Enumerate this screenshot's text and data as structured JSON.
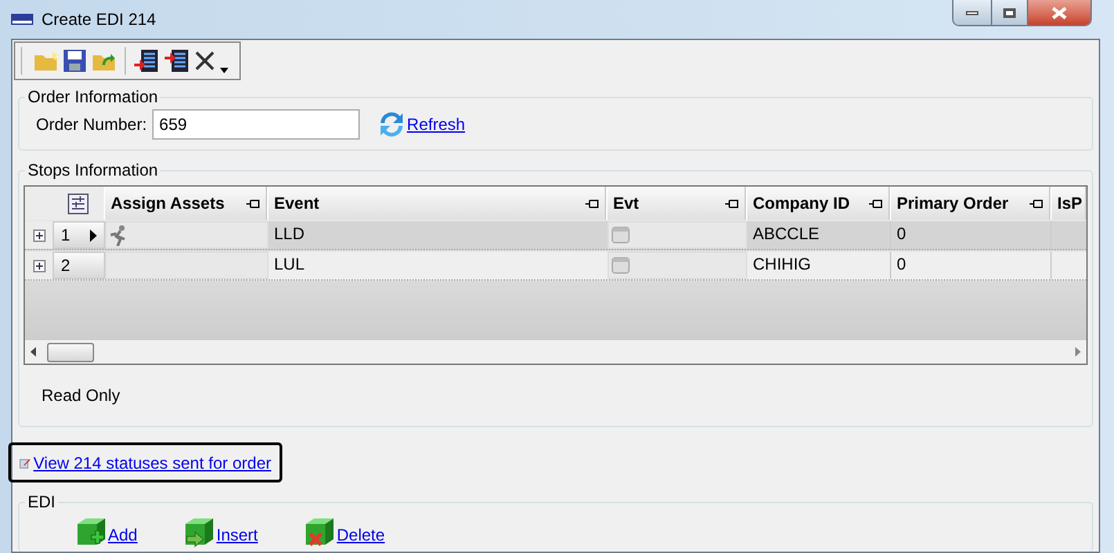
{
  "window": {
    "title": "Create EDI 214"
  },
  "order_information": {
    "title": "Order Information",
    "order_number_label": "Order Number:",
    "order_number": "659",
    "refresh": "Refresh"
  },
  "stops_information": {
    "title": "Stops Information",
    "columns": [
      "Assign Assets",
      "Event",
      "Evt",
      "Company ID",
      "Primary Order",
      "IsP"
    ],
    "rows": [
      {
        "number": "1",
        "selected": true,
        "expanded": false,
        "event": "LLD",
        "company_id": "ABCCLE",
        "primary_order": "0"
      },
      {
        "number": "2",
        "selected": false,
        "expanded": false,
        "event": "LUL",
        "company_id": "CHIHIG",
        "primary_order": "0"
      }
    ],
    "status": "Read Only"
  },
  "view_statuses_link": "View 214 statuses sent for order",
  "edi": {
    "title": "EDI",
    "actions": [
      {
        "kind": "add",
        "label": "Add"
      },
      {
        "kind": "insert",
        "label": "Insert"
      },
      {
        "kind": "delete",
        "label": "Delete"
      }
    ]
  }
}
